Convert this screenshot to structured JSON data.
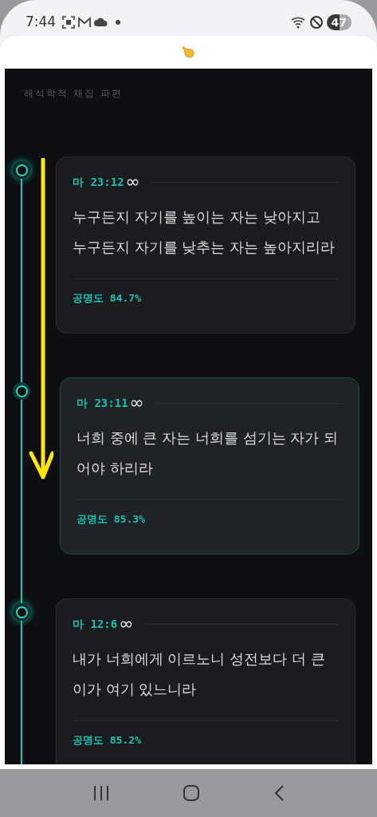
{
  "status_bar": {
    "time": "7:44",
    "battery": "47"
  },
  "header": {
    "title": "해석학적 채집 파편"
  },
  "entries": [
    {
      "book": "마",
      "ref": "23:12",
      "mark": "∞",
      "text": "누구든지 자기를 높이는 자는 낮아지고 누구든지 자기를 낮추는 자는 높아지리라",
      "score": "공명도 84.7%",
      "selected": false
    },
    {
      "book": "마",
      "ref": "23:11",
      "mark": "∞",
      "text": "너희 중에 큰 자는 너희를 섬기는 자가 되어야 하리라",
      "score": "공명도 85.3%",
      "selected": true
    },
    {
      "book": "마",
      "ref": "12:6",
      "mark": "∞",
      "text": "내가 너희에게 이르노니 성전보다 더 큰 이가 여기 있느니라",
      "score": "공명도 85.2%",
      "selected": false
    }
  ]
}
